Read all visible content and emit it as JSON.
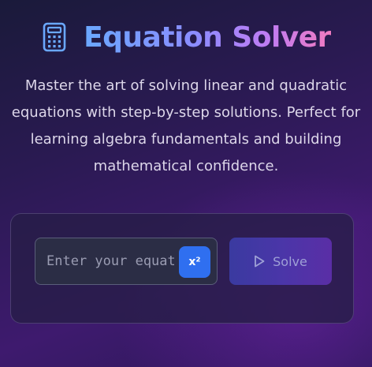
{
  "header": {
    "icon": "calculator-icon",
    "title": "Equation Solver"
  },
  "intro": {
    "description": "Master the art of solving linear and quadratic equations with step-by-step solutions. Perfect for learning algebra fundamentals and building mathematical confidence."
  },
  "solver": {
    "input_placeholder": "Enter your equation",
    "input_value": "",
    "square_button_label": "x²",
    "solve_button_icon": "play-icon",
    "solve_button_label": "Solve"
  },
  "colors": {
    "title_gradient_start": "#6aa8ff",
    "title_gradient_end": "#f07bc0",
    "accent_blue": "#2f6ff0",
    "solve_button": "#4a36a8"
  }
}
